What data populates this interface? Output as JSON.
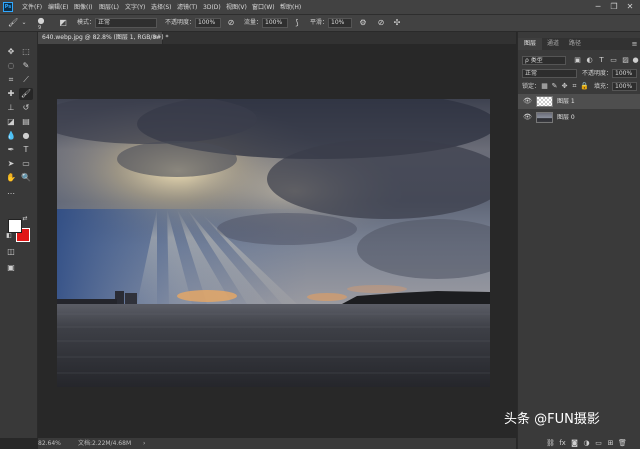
{
  "app": {
    "logo": "Ps"
  },
  "menu": [
    "文件(F)",
    "编辑(E)",
    "图像(I)",
    "图层(L)",
    "文字(Y)",
    "选择(S)",
    "滤镜(T)",
    "3D(D)",
    "视图(V)",
    "窗口(W)",
    "帮助(H)"
  ],
  "window": {
    "minimize": "─",
    "restore": "❐",
    "close": "✕"
  },
  "options": {
    "brush_size": "9",
    "mode_label": "模式：",
    "mode_value": "正常",
    "opacity_label": "不透明度：",
    "opacity_value": "100%",
    "flow_label": "流量：",
    "flow_value": "100%",
    "smooth_label": "平滑：",
    "smooth_value": "10%"
  },
  "document": {
    "tab_title": "640.webp.jpg @ 82.8% (图层 1, RGB/8#) *",
    "close": "×"
  },
  "status": {
    "zoom": "82.64%",
    "doc_size": "文档:2.22M/4.68M",
    "arrow": "›"
  },
  "panel": {
    "tabs": [
      "图层",
      "通道",
      "路径"
    ],
    "filter_kind": "ρ 类型",
    "blend_mode": "正常",
    "opacity_label": "不透明度：",
    "opacity_value": "100%",
    "lock_label": "锁定：",
    "fill_label": "填充：",
    "fill_value": "100%",
    "layers": [
      {
        "name": "图层 1"
      },
      {
        "name": "图层 0"
      }
    ]
  },
  "watermark": "头条 @FUN摄影",
  "colors": {
    "foreground": "#ffffff",
    "background": "#e01818",
    "accent": "#31a8ff"
  }
}
